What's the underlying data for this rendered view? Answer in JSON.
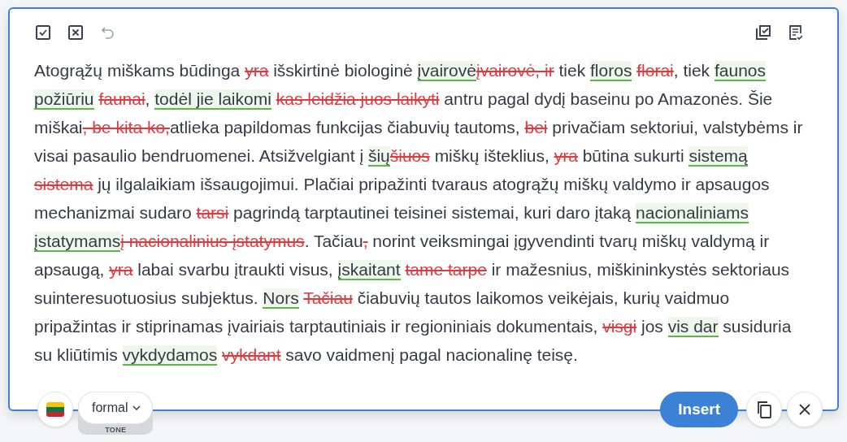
{
  "toolbar": {
    "undo": {
      "disabled": true
    }
  },
  "text": [
    {
      "kind": "plain",
      "text": "Atogrąžų miškams būdinga "
    },
    {
      "kind": "delete",
      "text": "yra"
    },
    {
      "kind": "plain",
      "text": " išskirtinė biologinė "
    },
    {
      "kind": "insert",
      "text": "įvairovė"
    },
    {
      "kind": "delete",
      "text": "įvairovė, ir"
    },
    {
      "kind": "plain",
      "text": " tiek "
    },
    {
      "kind": "insert",
      "text": "floros",
      "space_after": true
    },
    {
      "kind": "delete",
      "text": "florai"
    },
    {
      "kind": "plain",
      "text": ", tiek "
    },
    {
      "kind": "insert",
      "text": "faunos požiūriu",
      "space_after": true
    },
    {
      "kind": "delete",
      "text": "faunai"
    },
    {
      "kind": "plain",
      "text": ", "
    },
    {
      "kind": "insert",
      "text": "todėl jie laikomi",
      "space_after": true
    },
    {
      "kind": "delete",
      "text": "kas leidžia juos laikyti"
    },
    {
      "kind": "plain",
      "text": " antru pagal dydį baseinu po Amazonės. Šie miškai"
    },
    {
      "kind": "delete",
      "text": ", be kita ko,"
    },
    {
      "kind": "plain",
      "text": "atlieka papildomas funkcijas čiabuvių tautoms, "
    },
    {
      "kind": "delete",
      "text": "bei"
    },
    {
      "kind": "plain",
      "text": " privačiam sektoriui, valstybėms ir visai pasaulio bendruomenei. Atsižvelgiant į "
    },
    {
      "kind": "insert",
      "text": "šių"
    },
    {
      "kind": "delete",
      "text": "šiuos"
    },
    {
      "kind": "plain",
      "text": " miškų išteklius, "
    },
    {
      "kind": "delete",
      "text": "yra"
    },
    {
      "kind": "plain",
      "text": " būtina sukurti "
    },
    {
      "kind": "insert",
      "text": "sistemą",
      "space_after": true
    },
    {
      "kind": "delete",
      "text": "sistema"
    },
    {
      "kind": "plain",
      "text": " jų ilgalaikiam išsaugojimui. Plačiai pripažinti tvaraus atogrąžų miškų valdymo ir apsaugos mechanizmai sudaro "
    },
    {
      "kind": "delete",
      "text": "tarsi"
    },
    {
      "kind": "plain",
      "text": " pagrindą tarptautinei teisinei sistemai, kuri daro įtaką "
    },
    {
      "kind": "insert",
      "text": "nacionaliniams įstatymams"
    },
    {
      "kind": "delete",
      "text": "į nacionalinius įstatymus"
    },
    {
      "kind": "plain",
      "text": ". Tačiau"
    },
    {
      "kind": "delete",
      "text": ","
    },
    {
      "kind": "plain",
      "text": " norint veiksmingai įgyvendinti tvarų miškų valdymą ir apsaugą, "
    },
    {
      "kind": "delete",
      "text": "yra"
    },
    {
      "kind": "plain",
      "text": " labai svarbu įtraukti visus, "
    },
    {
      "kind": "insert",
      "text": "įskaitant",
      "space_after": true
    },
    {
      "kind": "delete",
      "text": "tame tarpe"
    },
    {
      "kind": "plain",
      "text": " ir mažesnius, miškininkystės sektoriaus suinteresuotuosius subjektus. "
    },
    {
      "kind": "insert",
      "text": "Nors",
      "space_after": true
    },
    {
      "kind": "delete",
      "text": "Tačiau"
    },
    {
      "kind": "plain",
      "text": " čiabuvių tautos laikomos veikėjais, kurių vaidmuo pripažintas ir stiprinamas įvairiais tarptautiniais ir regioniniais dokumentais, "
    },
    {
      "kind": "delete",
      "text": "visgi"
    },
    {
      "kind": "plain",
      "text": " jos "
    },
    {
      "kind": "insert",
      "text": "vis dar"
    },
    {
      "kind": "plain",
      "text": " susiduria su kliūtimis "
    },
    {
      "kind": "insert",
      "text": "vykdydamos",
      "space_after": true
    },
    {
      "kind": "delete",
      "text": "vykdant"
    },
    {
      "kind": "plain",
      "text": " savo vaidmenį pagal nacionalinę teisę."
    }
  ],
  "tone": {
    "value": "formal",
    "label": "TONE"
  },
  "insert_button": "Insert"
}
